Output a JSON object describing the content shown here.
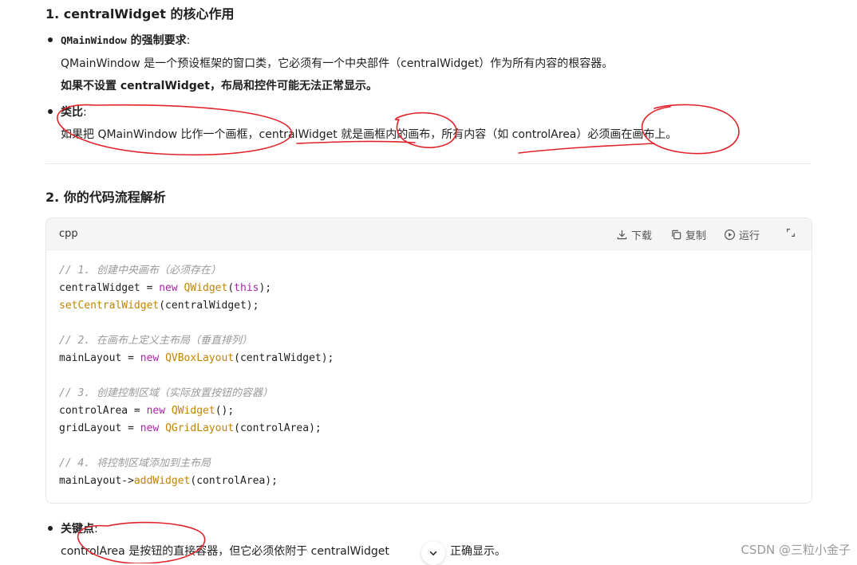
{
  "section1": {
    "title": "1. centralWidget 的核心作用",
    "bullet1": {
      "label_code": "QMainWindow",
      "label_rest": " 的强制要求",
      "colon": ":",
      "line1": "QMainWindow 是一个预设框架的窗口类，它必须有一个中央部件（centralWidget）作为所有内容的根容器。",
      "line2": "如果不设置 centralWidget，布局和控件可能无法正常显示。"
    },
    "bullet2": {
      "label": "类比",
      "colon": ":",
      "line1": "如果把 QMainWindow 比作一个画框，centralWidget 就是画框内的画布，所有内容（如 controlArea）必须画在画布上。"
    }
  },
  "section2": {
    "title": "2. 你的代码流程解析",
    "code": {
      "lang": "cpp",
      "toolbar": {
        "download": "下载",
        "copy": "复制",
        "run": "运行"
      },
      "lines": [
        [
          {
            "t": "// 1. 创建中央画布（必须存在）",
            "c": "c-cm"
          }
        ],
        [
          {
            "t": "centralWidget = "
          },
          {
            "t": "new",
            "c": "c-kw"
          },
          {
            "t": " "
          },
          {
            "t": "QWidget",
            "c": "c-fn"
          },
          {
            "t": "("
          },
          {
            "t": "this",
            "c": "c-kw"
          },
          {
            "t": ");"
          }
        ],
        [
          {
            "t": "setCentralWidget",
            "c": "c-fn"
          },
          {
            "t": "(centralWidget);"
          }
        ],
        [],
        [
          {
            "t": "// 2. 在画布上定义主布局（垂直排列）",
            "c": "c-cm"
          }
        ],
        [
          {
            "t": "mainLayout = "
          },
          {
            "t": "new",
            "c": "c-kw"
          },
          {
            "t": " "
          },
          {
            "t": "QVBoxLayout",
            "c": "c-fn"
          },
          {
            "t": "(centralWidget);"
          }
        ],
        [],
        [
          {
            "t": "// 3. 创建控制区域（实际放置按钮的容器）",
            "c": "c-cm"
          }
        ],
        [
          {
            "t": "controlArea = "
          },
          {
            "t": "new",
            "c": "c-kw"
          },
          {
            "t": " "
          },
          {
            "t": "QWidget",
            "c": "c-fn"
          },
          {
            "t": "();"
          }
        ],
        [
          {
            "t": "gridLayout = "
          },
          {
            "t": "new",
            "c": "c-kw"
          },
          {
            "t": " "
          },
          {
            "t": "QGridLayout",
            "c": "c-fn"
          },
          {
            "t": "(controlArea);"
          }
        ],
        [],
        [
          {
            "t": "// 4. 将控制区域添加到主布局",
            "c": "c-cm"
          }
        ],
        [
          {
            "t": "mainLayout->"
          },
          {
            "t": "addWidget",
            "c": "c-fn"
          },
          {
            "t": "(controlArea);"
          }
        ]
      ]
    }
  },
  "section3": {
    "bullet": {
      "label": "关键点",
      "colon": ":",
      "line1_a": "controlArea 是按钮的直接容器，但它必须依附于 centralWidget",
      "line1_b": "正确显示。"
    }
  },
  "watermark": "CSDN @三粒小金子",
  "colors": {
    "annotation": "#e0232a",
    "code_keyword": "#a626a4",
    "code_type": "#c18401",
    "code_comment": "#999999"
  },
  "icons": [
    "download-icon",
    "copy-icon",
    "run-icon",
    "expand-icon",
    "chevron-down-icon"
  ]
}
